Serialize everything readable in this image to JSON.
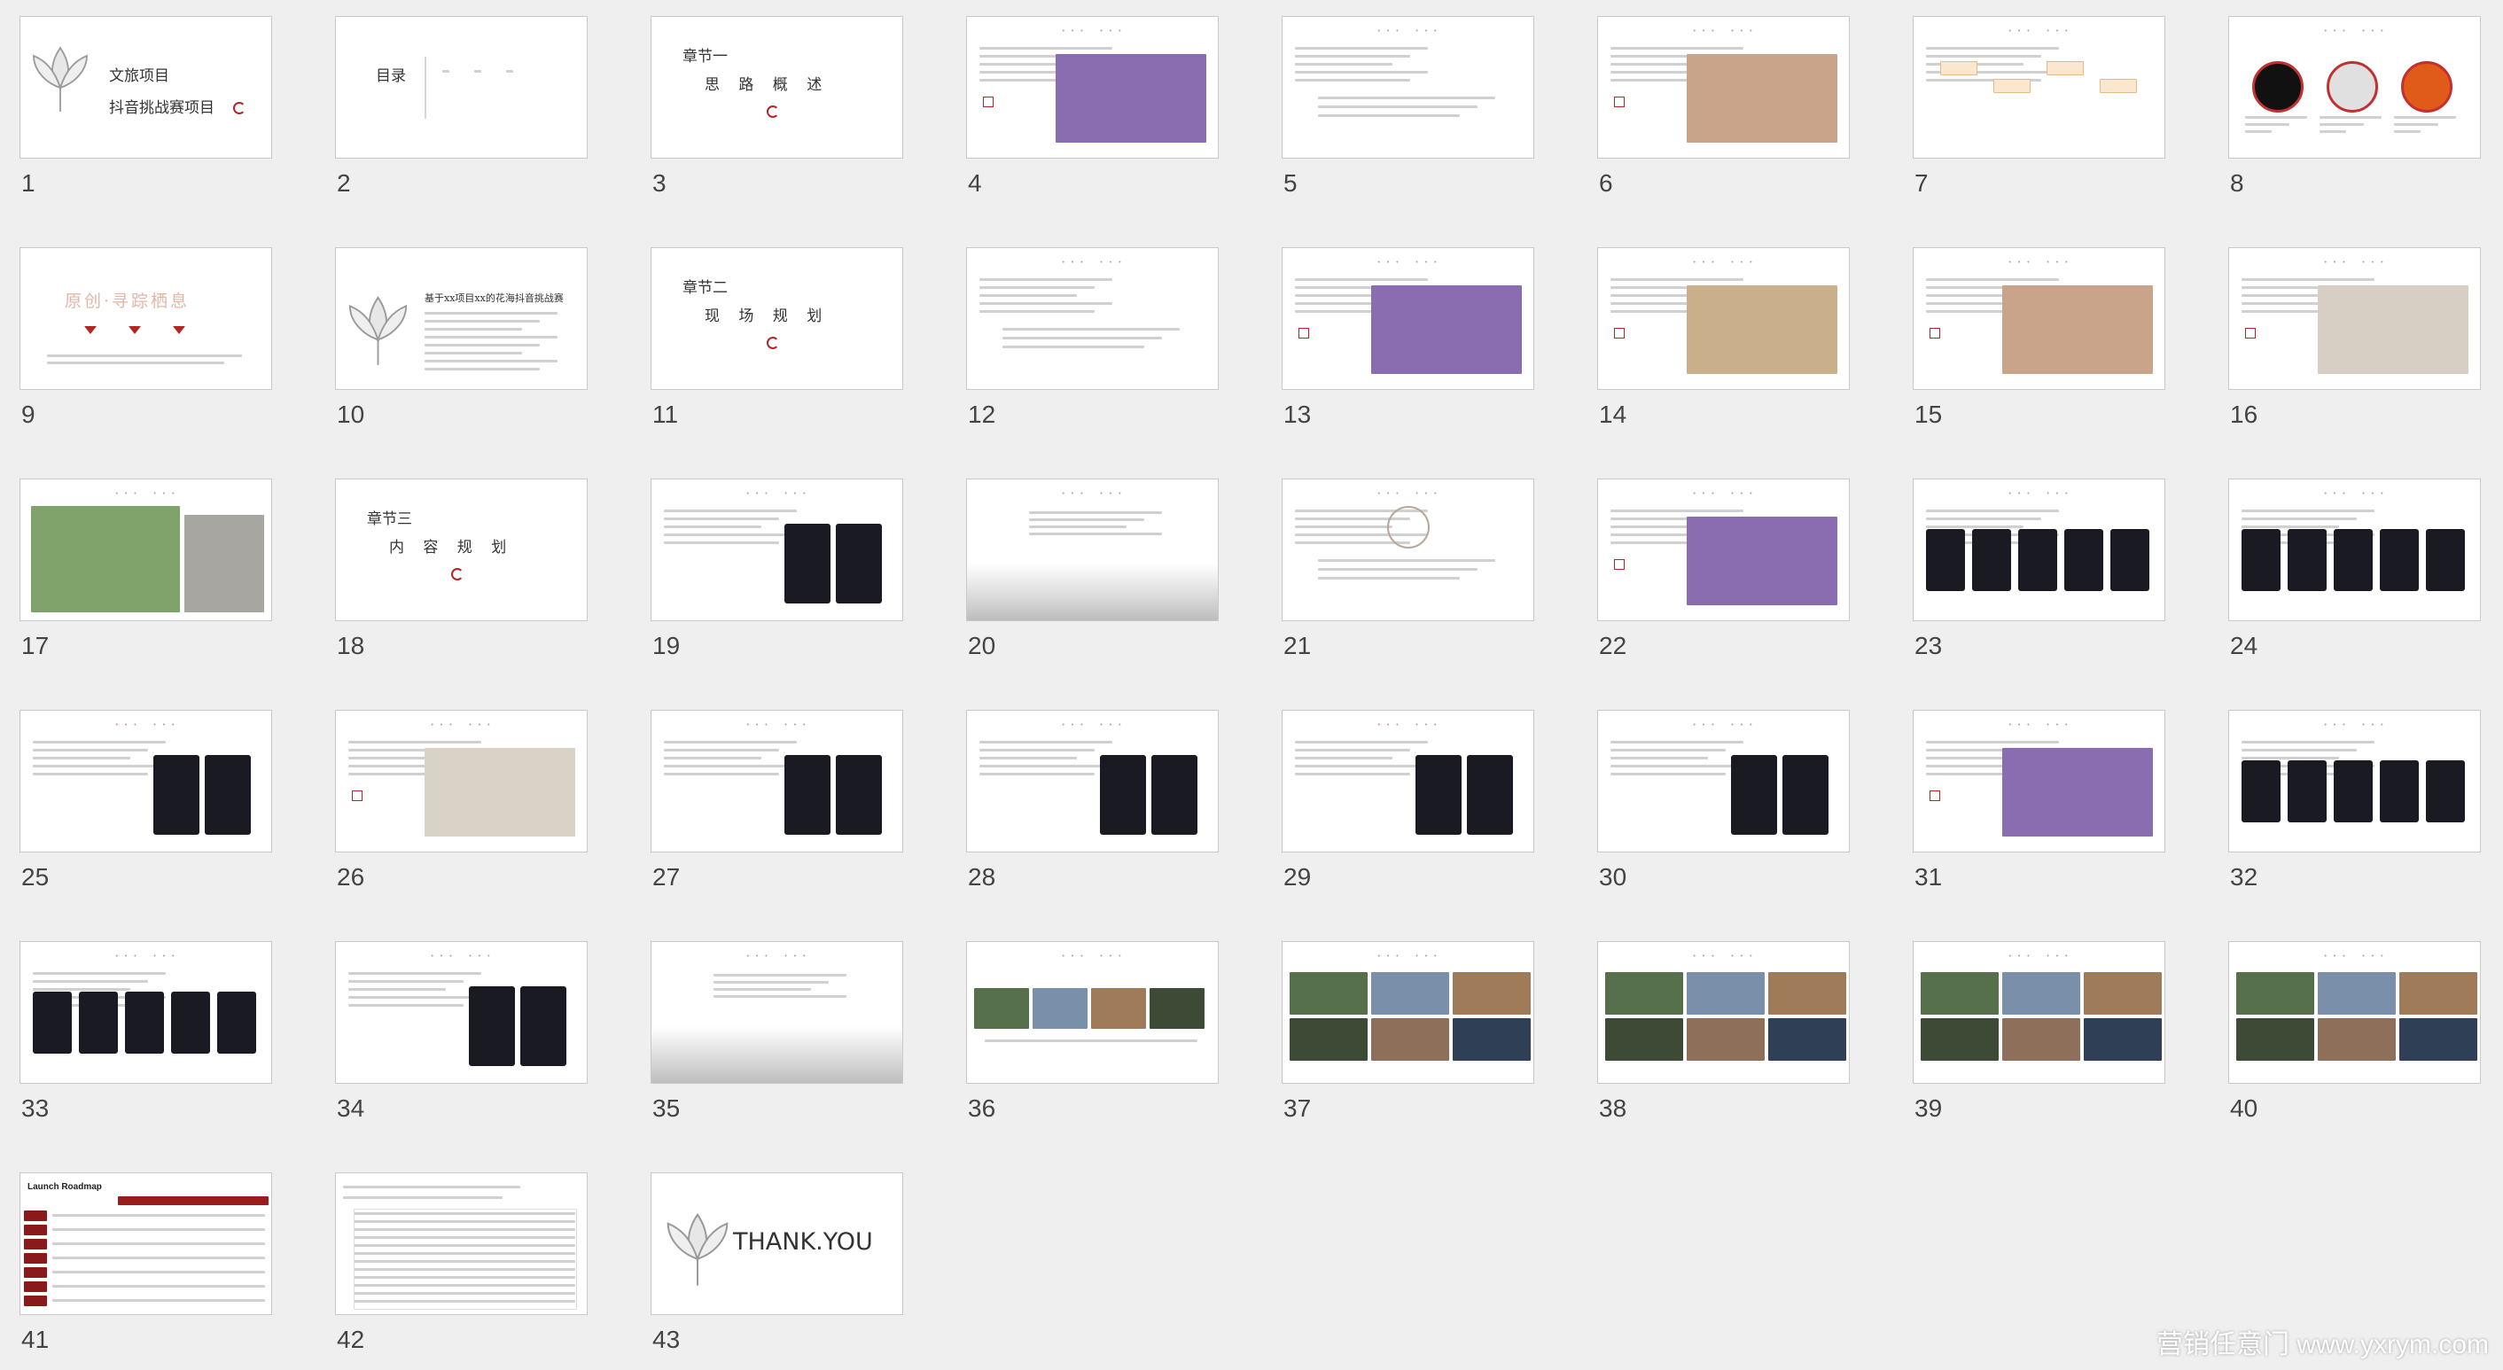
{
  "slides": [
    {
      "num": "1",
      "lines": [
        "文旅项目",
        "抖音挑战赛项目"
      ]
    },
    {
      "num": "2",
      "lines": [
        "目录"
      ]
    },
    {
      "num": "3",
      "lines": [
        "章节一",
        "思 路 概 述"
      ]
    },
    {
      "num": "4",
      "lines": []
    },
    {
      "num": "5",
      "lines": []
    },
    {
      "num": "6",
      "lines": []
    },
    {
      "num": "7",
      "lines": []
    },
    {
      "num": "8",
      "lines": []
    },
    {
      "num": "9",
      "lines": [
        "原创·寻踪栖息"
      ]
    },
    {
      "num": "10",
      "lines": [
        "基于xx项目xx的花海抖音挑战赛"
      ]
    },
    {
      "num": "11",
      "lines": [
        "章节二",
        "现 场 规 划"
      ]
    },
    {
      "num": "12",
      "lines": []
    },
    {
      "num": "13",
      "lines": []
    },
    {
      "num": "14",
      "lines": []
    },
    {
      "num": "15",
      "lines": []
    },
    {
      "num": "16",
      "lines": []
    },
    {
      "num": "17",
      "lines": []
    },
    {
      "num": "18",
      "lines": [
        "章节三",
        "内 容 规 划"
      ]
    },
    {
      "num": "19",
      "lines": []
    },
    {
      "num": "20",
      "lines": []
    },
    {
      "num": "21",
      "lines": []
    },
    {
      "num": "22",
      "lines": []
    },
    {
      "num": "23",
      "lines": []
    },
    {
      "num": "24",
      "lines": []
    },
    {
      "num": "25",
      "lines": []
    },
    {
      "num": "26",
      "lines": []
    },
    {
      "num": "27",
      "lines": []
    },
    {
      "num": "28",
      "lines": []
    },
    {
      "num": "29",
      "lines": []
    },
    {
      "num": "30",
      "lines": []
    },
    {
      "num": "31",
      "lines": []
    },
    {
      "num": "32",
      "lines": []
    },
    {
      "num": "33",
      "lines": []
    },
    {
      "num": "34",
      "lines": []
    },
    {
      "num": "35",
      "lines": []
    },
    {
      "num": "36",
      "lines": []
    },
    {
      "num": "37",
      "lines": []
    },
    {
      "num": "38",
      "lines": []
    },
    {
      "num": "39",
      "lines": []
    },
    {
      "num": "40",
      "lines": []
    },
    {
      "num": "41",
      "lines": [
        "Launch Roadmap"
      ]
    },
    {
      "num": "42",
      "lines": []
    },
    {
      "num": "43",
      "lines": [
        "THANK.YOU"
      ]
    }
  ],
  "watermark": "营销任意门 www.yxrym.com"
}
